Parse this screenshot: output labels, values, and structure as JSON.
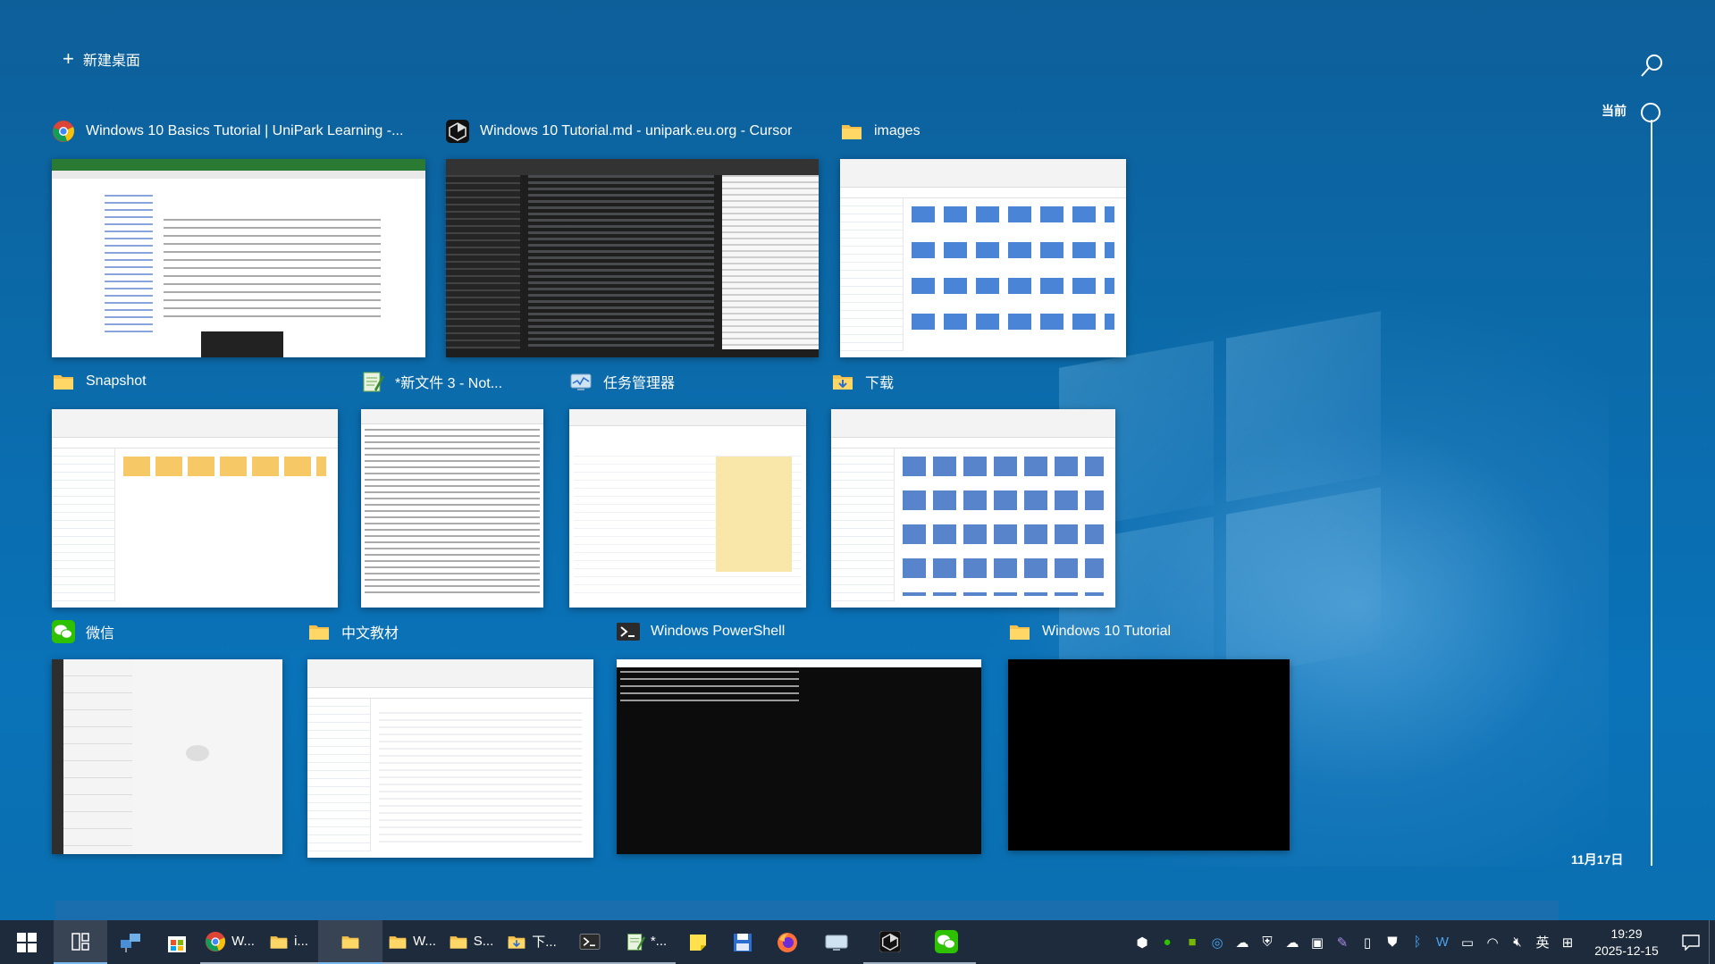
{
  "top_bar": {
    "new_desktop_label": "新建桌面",
    "search_icon": "search-icon"
  },
  "timeline": {
    "now_label": "当前",
    "date_label": "11月17日"
  },
  "windows": [
    {
      "title": "Windows 10 Basics Tutorial | UniPark Learning -...",
      "app": "chrome"
    },
    {
      "title": "Windows 10 Tutorial.md - unipark.eu.org - Cursor",
      "app": "cursor"
    },
    {
      "title": "images",
      "app": "explorer"
    },
    {
      "title": "Snapshot",
      "app": "explorer"
    },
    {
      "title": "*新文件 3 - Not...",
      "app": "notepad"
    },
    {
      "title": "任务管理器",
      "app": "task-manager"
    },
    {
      "title": "下载",
      "app": "explorer"
    },
    {
      "title": "微信",
      "app": "wechat"
    },
    {
      "title": "中文教材",
      "app": "explorer"
    },
    {
      "title": "Windows PowerShell",
      "app": "powershell"
    },
    {
      "title": "Windows 10 Tutorial",
      "app": "explorer"
    }
  ],
  "taskbar": {
    "items": [
      {
        "label": "W...",
        "icon": "chrome-icon"
      },
      {
        "label": "i...",
        "icon": "folder-icon"
      },
      {
        "label": "",
        "icon": "folder-icon"
      },
      {
        "label": "W...",
        "icon": "folder-icon"
      },
      {
        "label": "S...",
        "icon": "folder-icon"
      },
      {
        "label": "下...",
        "icon": "download-folder-icon"
      },
      {
        "label": "",
        "icon": "powershell-icon"
      },
      {
        "label": "*...",
        "icon": "notepad-icon"
      }
    ],
    "tray_ime": "英",
    "time": "19:29",
    "date": "2025-12-15"
  },
  "colors": {
    "desktop_blue": "#0b6aa9",
    "taskbar": "#1d2b3c",
    "folder_yellow": "#f5c04c",
    "active_indicator": "#79b8ec"
  }
}
